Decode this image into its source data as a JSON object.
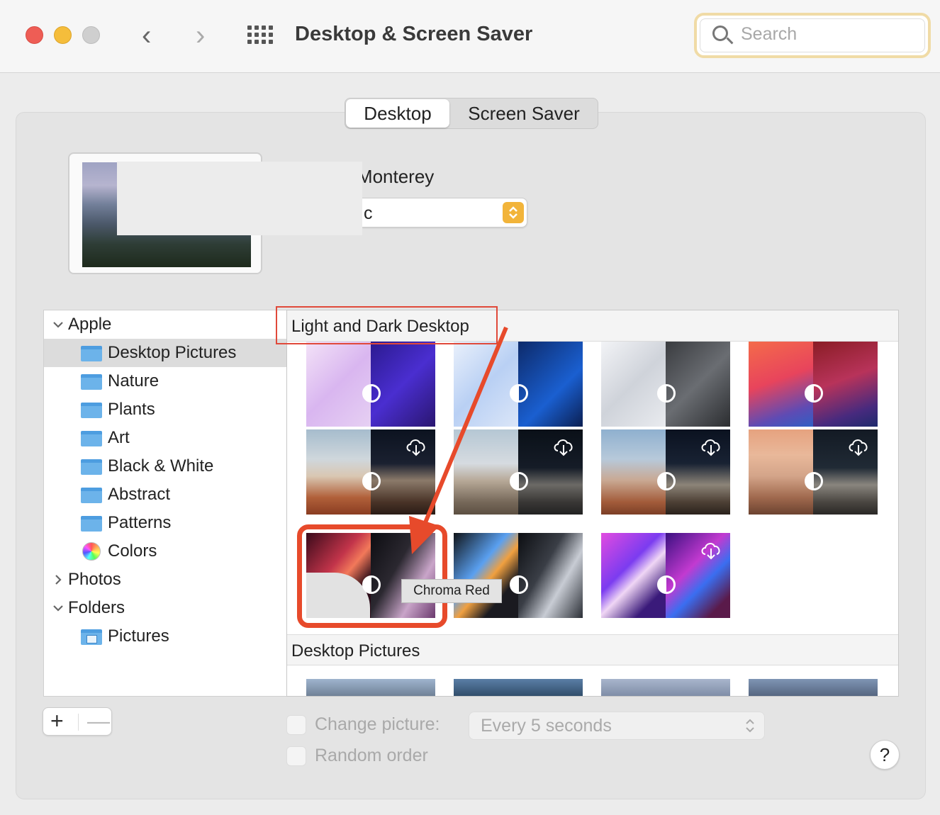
{
  "window": {
    "title": "Desktop & Screen Saver"
  },
  "search": {
    "placeholder": "Search"
  },
  "tabs": [
    {
      "label": "Desktop",
      "active": true
    },
    {
      "label": "Screen Saver",
      "active": false
    }
  ],
  "wallpaper": {
    "name_visible": "Monterey",
    "mode_visible": "c"
  },
  "sidebar": {
    "groups": [
      {
        "label": "Apple",
        "expanded": true,
        "items": [
          "Desktop Pictures",
          "Nature",
          "Plants",
          "Art",
          "Black & White",
          "Abstract",
          "Patterns",
          "Colors"
        ],
        "selected": "Desktop Pictures"
      },
      {
        "label": "Photos",
        "expanded": false
      },
      {
        "label": "Folders",
        "expanded": true,
        "items": [
          "Pictures"
        ]
      }
    ]
  },
  "gallery": {
    "sections": [
      "Light and Dark Desktop",
      "Desktop Pictures"
    ],
    "tooltip": "Chroma Red"
  },
  "footer": {
    "add_label": "+",
    "remove_label": "—",
    "change_picture_label": "Change picture:",
    "interval_value": "Every 5 seconds",
    "random_order_label": "Random order",
    "help_label": "?"
  },
  "colors": {
    "accent": "#f2b43a",
    "annotation": "#e74a2b",
    "close": "#ee5d55",
    "minimize": "#f5bd3b",
    "zoom_inactive": "#cfcfcf"
  }
}
